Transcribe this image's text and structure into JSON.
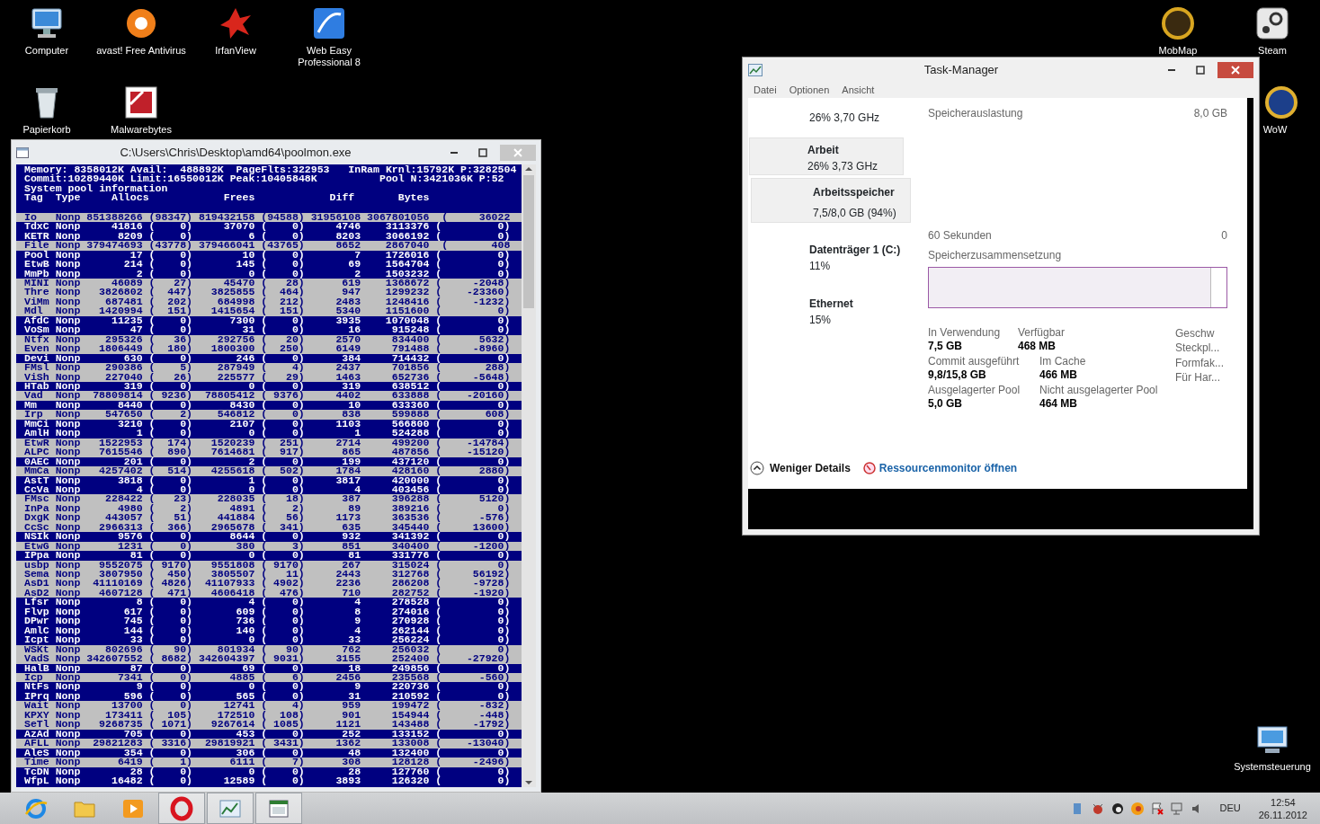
{
  "desktop_icons": [
    {
      "kind": "computer",
      "label": "Computer"
    },
    {
      "kind": "antivirus",
      "label": "avast! Free Antivirus"
    },
    {
      "kind": "image-viewer",
      "label": "IrfanView"
    },
    {
      "kind": "web-editor",
      "label": "Web Easy Professional 8"
    },
    {
      "kind": "recycle-bin",
      "label": "Papierkorb"
    },
    {
      "kind": "malware-scanner",
      "label": "Malwarebytes"
    },
    {
      "kind": "map-tool",
      "label": "MobMap"
    },
    {
      "kind": "game-client",
      "label": "Steam"
    },
    {
      "kind": "game",
      "label": "WoW"
    },
    {
      "kind": "control-panel",
      "label": "Systemsteuerung"
    }
  ],
  "console_window": {
    "title": "C:\\Users\\Chris\\Desktop\\amd64\\poolmon.exe",
    "header_lines": [
      "Memory: 8358012K Avail:  488892K  PageFlts:322953   InRam Krnl:15792K P:3282504",
      "Commit:10289440K Limit:16550012K Peak:10405848K          Pool N:3421036K P:52",
      "System pool information",
      "Tag  Type     Allocs            Frees            Diff       Bytes"
    ],
    "rows": [
      {
        "tag": "Io",
        "type": "Nonp",
        "allocs": "851388266",
        "allocs_change": "(98347)",
        "frees": "819432158",
        "frees_change": "(94588)",
        "diff": "31956108",
        "bytes": "3067801056",
        "bytes_change": "(     36022",
        "changed": true
      },
      {
        "tag": "TdxC",
        "type": "Nonp",
        "allocs": "41816",
        "allocs_change": "(    0)",
        "frees": "37070",
        "frees_change": "(    0)",
        "diff": "4746",
        "bytes": "3113376",
        "bytes_change": "(         0)",
        "changed": false
      },
      {
        "tag": "KETR",
        "type": "Nonp",
        "allocs": "8209",
        "allocs_change": "(    0)",
        "frees": "6",
        "frees_change": "(    0)",
        "diff": "8203",
        "bytes": "3066192",
        "bytes_change": "(         0)",
        "changed": false
      },
      {
        "tag": "File",
        "type": "Nonp",
        "allocs": "379474693",
        "allocs_change": "(43778)",
        "frees": "379466041",
        "frees_change": "(43765)",
        "diff": "8652",
        "bytes": "2867040",
        "bytes_change": "(       408",
        "changed": true
      },
      {
        "tag": "Pool",
        "type": "Nonp",
        "allocs": "17",
        "allocs_change": "(    0)",
        "frees": "10",
        "frees_change": "(    0)",
        "diff": "7",
        "bytes": "1726016",
        "bytes_change": "(         0)",
        "changed": false
      },
      {
        "tag": "EtwB",
        "type": "Nonp",
        "allocs": "214",
        "allocs_change": "(    0)",
        "frees": "145",
        "frees_change": "(    0)",
        "diff": "69",
        "bytes": "1564704",
        "bytes_change": "(         0)",
        "changed": false
      },
      {
        "tag": "MmPb",
        "type": "Nonp",
        "allocs": "2",
        "allocs_change": "(    0)",
        "frees": "0",
        "frees_change": "(    0)",
        "diff": "2",
        "bytes": "1503232",
        "bytes_change": "(         0)",
        "changed": false
      },
      {
        "tag": "MINI",
        "type": "Nonp",
        "allocs": "46089",
        "allocs_change": "(   27)",
        "frees": "45470",
        "frees_change": "(   28)",
        "diff": "619",
        "bytes": "1368672",
        "bytes_change": "(     -2048)",
        "changed": true
      },
      {
        "tag": "Thre",
        "type": "Nonp",
        "allocs": "3826802",
        "allocs_change": "(  447)",
        "frees": "3825855",
        "frees_change": "(  464)",
        "diff": "947",
        "bytes": "1299232",
        "bytes_change": "(    -23360)",
        "changed": true
      },
      {
        "tag": "ViMm",
        "type": "Nonp",
        "allocs": "687481",
        "allocs_change": "(  202)",
        "frees": "684998",
        "frees_change": "(  212)",
        "diff": "2483",
        "bytes": "1248416",
        "bytes_change": "(     -1232)",
        "changed": true
      },
      {
        "tag": "Mdl",
        "type": "Nonp",
        "allocs": "1420994",
        "allocs_change": "(  151)",
        "frees": "1415654",
        "frees_change": "(  151)",
        "diff": "5340",
        "bytes": "1151600",
        "bytes_change": "(         0)",
        "changed": true
      },
      {
        "tag": "AfdC",
        "type": "Nonp",
        "allocs": "11235",
        "allocs_change": "(    0)",
        "frees": "7300",
        "frees_change": "(    0)",
        "diff": "3935",
        "bytes": "1070048",
        "bytes_change": "(         0)",
        "changed": false
      },
      {
        "tag": "VoSm",
        "type": "Nonp",
        "allocs": "47",
        "allocs_change": "(    0)",
        "frees": "31",
        "frees_change": "(    0)",
        "diff": "16",
        "bytes": "915248",
        "bytes_change": "(         0)",
        "changed": false
      },
      {
        "tag": "Ntfx",
        "type": "Nonp",
        "allocs": "295326",
        "allocs_change": "(   36)",
        "frees": "292756",
        "frees_change": "(   20)",
        "diff": "2570",
        "bytes": "834400",
        "bytes_change": "(      5632)",
        "changed": true
      },
      {
        "tag": "Even",
        "type": "Nonp",
        "allocs": "1806449",
        "allocs_change": "(  180)",
        "frees": "1800300",
        "frees_change": "(  250)",
        "diff": "6149",
        "bytes": "791488",
        "bytes_change": "(     -8960)",
        "changed": true
      },
      {
        "tag": "Devi",
        "type": "Nonp",
        "allocs": "630",
        "allocs_change": "(    0)",
        "frees": "246",
        "frees_change": "(    0)",
        "diff": "384",
        "bytes": "714432",
        "bytes_change": "(         0)",
        "changed": false
      },
      {
        "tag": "FMsl",
        "type": "Nonp",
        "allocs": "290386",
        "allocs_change": "(    5)",
        "frees": "287949",
        "frees_change": "(    4)",
        "diff": "2437",
        "bytes": "701856",
        "bytes_change": "(       288)",
        "changed": true
      },
      {
        "tag": "ViSh",
        "type": "Nonp",
        "allocs": "227040",
        "allocs_change": "(   26)",
        "frees": "225577",
        "frees_change": "(   29)",
        "diff": "1463",
        "bytes": "652736",
        "bytes_change": "(     -5648)",
        "changed": true
      },
      {
        "tag": "HTab",
        "type": "Nonp",
        "allocs": "319",
        "allocs_change": "(    0)",
        "frees": "0",
        "frees_change": "(    0)",
        "diff": "319",
        "bytes": "638512",
        "bytes_change": "(         0)",
        "changed": false
      },
      {
        "tag": "Vad",
        "type": "Nonp",
        "allocs": "78809814",
        "allocs_change": "( 9236)",
        "frees": "78805412",
        "frees_change": "( 9376)",
        "diff": "4402",
        "bytes": "633888",
        "bytes_change": "(    -20160)",
        "changed": true
      },
      {
        "tag": "Mm",
        "type": "Nonp",
        "allocs": "8440",
        "allocs_change": "(    0)",
        "frees": "8430",
        "frees_change": "(    0)",
        "diff": "10",
        "bytes": "633360",
        "bytes_change": "(         0)",
        "changed": false
      },
      {
        "tag": "Irp",
        "type": "Nonp",
        "allocs": "547650",
        "allocs_change": "(    2)",
        "frees": "546812",
        "frees_change": "(    0)",
        "diff": "838",
        "bytes": "599888",
        "bytes_change": "(       608)",
        "changed": true
      },
      {
        "tag": "MmCi",
        "type": "Nonp",
        "allocs": "3210",
        "allocs_change": "(    0)",
        "frees": "2107",
        "frees_change": "(    0)",
        "diff": "1103",
        "bytes": "566800",
        "bytes_change": "(         0)",
        "changed": false
      },
      {
        "tag": "AmlH",
        "type": "Nonp",
        "allocs": "1",
        "allocs_change": "(    0)",
        "frees": "0",
        "frees_change": "(    0)",
        "diff": "1",
        "bytes": "524288",
        "bytes_change": "(         0)",
        "changed": false
      },
      {
        "tag": "EtwR",
        "type": "Nonp",
        "allocs": "1522953",
        "allocs_change": "(  174)",
        "frees": "1520239",
        "frees_change": "(  251)",
        "diff": "2714",
        "bytes": "499200",
        "bytes_change": "(    -14784)",
        "changed": true
      },
      {
        "tag": "ALPC",
        "type": "Nonp",
        "allocs": "7615546",
        "allocs_change": "(  890)",
        "frees": "7614681",
        "frees_change": "(  917)",
        "diff": "865",
        "bytes": "487856",
        "bytes_change": "(    -15120)",
        "changed": true
      },
      {
        "tag": "0AEC",
        "type": "Nonp",
        "allocs": "201",
        "allocs_change": "(    0)",
        "frees": "2",
        "frees_change": "(    0)",
        "diff": "199",
        "bytes": "437120",
        "bytes_change": "(         0)",
        "changed": false
      },
      {
        "tag": "MmCa",
        "type": "Nonp",
        "allocs": "4257402",
        "allocs_change": "(  514)",
        "frees": "4255618",
        "frees_change": "(  502)",
        "diff": "1784",
        "bytes": "428160",
        "bytes_change": "(      2880)",
        "changed": true
      },
      {
        "tag": "AstT",
        "type": "Nonp",
        "allocs": "3818",
        "allocs_change": "(    0)",
        "frees": "1",
        "frees_change": "(    0)",
        "diff": "3817",
        "bytes": "420000",
        "bytes_change": "(         0)",
        "changed": false
      },
      {
        "tag": "CcVa",
        "type": "Nonp",
        "allocs": "4",
        "allocs_change": "(    0)",
        "frees": "0",
        "frees_change": "(    0)",
        "diff": "4",
        "bytes": "403456",
        "bytes_change": "(         0)",
        "changed": false
      },
      {
        "tag": "FMsc",
        "type": "Nonp",
        "allocs": "228422",
        "allocs_change": "(   23)",
        "frees": "228035",
        "frees_change": "(   18)",
        "diff": "387",
        "bytes": "396288",
        "bytes_change": "(      5120)",
        "changed": true
      },
      {
        "tag": "InPa",
        "type": "Nonp",
        "allocs": "4980",
        "allocs_change": "(    2)",
        "frees": "4891",
        "frees_change": "(    2)",
        "diff": "89",
        "bytes": "389216",
        "bytes_change": "(         0)",
        "changed": true
      },
      {
        "tag": "DxgK",
        "type": "Nonp",
        "allocs": "443057",
        "allocs_change": "(   51)",
        "frees": "441884",
        "frees_change": "(   56)",
        "diff": "1173",
        "bytes": "363536",
        "bytes_change": "(      -576)",
        "changed": true
      },
      {
        "tag": "CcSc",
        "type": "Nonp",
        "allocs": "2966313",
        "allocs_change": "(  366)",
        "frees": "2965678",
        "frees_change": "(  341)",
        "diff": "635",
        "bytes": "345440",
        "bytes_change": "(     13600)",
        "changed": true
      },
      {
        "tag": "NSIk",
        "type": "Nonp",
        "allocs": "9576",
        "allocs_change": "(    0)",
        "frees": "8644",
        "frees_change": "(    0)",
        "diff": "932",
        "bytes": "341392",
        "bytes_change": "(         0)",
        "changed": false
      },
      {
        "tag": "EtwG",
        "type": "Nonp",
        "allocs": "1231",
        "allocs_change": "(    0)",
        "frees": "380",
        "frees_change": "(    3)",
        "diff": "851",
        "bytes": "340400",
        "bytes_change": "(     -1200)",
        "changed": true
      },
      {
        "tag": "IPpa",
        "type": "Nonp",
        "allocs": "81",
        "allocs_change": "(    0)",
        "frees": "0",
        "frees_change": "(    0)",
        "diff": "81",
        "bytes": "331776",
        "bytes_change": "(         0)",
        "changed": false
      },
      {
        "tag": "usbp",
        "type": "Nonp",
        "allocs": "9552075",
        "allocs_change": "( 9170)",
        "frees": "9551808",
        "frees_change": "( 9170)",
        "diff": "267",
        "bytes": "315024",
        "bytes_change": "(         0)",
        "changed": true
      },
      {
        "tag": "Sema",
        "type": "Nonp",
        "allocs": "3807950",
        "allocs_change": "(  450)",
        "frees": "3805507",
        "frees_change": "(   11)",
        "diff": "2443",
        "bytes": "312768",
        "bytes_change": "(     56192)",
        "changed": true
      },
      {
        "tag": "AsD1",
        "type": "Nonp",
        "allocs": "41110169",
        "allocs_change": "( 4826)",
        "frees": "41107933",
        "frees_change": "( 4902)",
        "diff": "2236",
        "bytes": "286208",
        "bytes_change": "(     -9728)",
        "changed": true
      },
      {
        "tag": "AsD2",
        "type": "Nonp",
        "allocs": "4607128",
        "allocs_change": "(  471)",
        "frees": "4606418",
        "frees_change": "(  476)",
        "diff": "710",
        "bytes": "282752",
        "bytes_change": "(     -1920)",
        "changed": true
      },
      {
        "tag": "Lfsr",
        "type": "Nonp",
        "allocs": "8",
        "allocs_change": "(    0)",
        "frees": "4",
        "frees_change": "(    0)",
        "diff": "4",
        "bytes": "278528",
        "bytes_change": "(         0)",
        "changed": false
      },
      {
        "tag": "Flvp",
        "type": "Nonp",
        "allocs": "617",
        "allocs_change": "(    0)",
        "frees": "609",
        "frees_change": "(    0)",
        "diff": "8",
        "bytes": "274016",
        "bytes_change": "(         0)",
        "changed": false
      },
      {
        "tag": "DPwr",
        "type": "Nonp",
        "allocs": "745",
        "allocs_change": "(    0)",
        "frees": "736",
        "frees_change": "(    0)",
        "diff": "9",
        "bytes": "270928",
        "bytes_change": "(         0)",
        "changed": false
      },
      {
        "tag": "AmlC",
        "type": "Nonp",
        "allocs": "144",
        "allocs_change": "(    0)",
        "frees": "140",
        "frees_change": "(    0)",
        "diff": "4",
        "bytes": "262144",
        "bytes_change": "(         0)",
        "changed": false
      },
      {
        "tag": "Icpt",
        "type": "Nonp",
        "allocs": "33",
        "allocs_change": "(    0)",
        "frees": "0",
        "frees_change": "(    0)",
        "diff": "33",
        "bytes": "256224",
        "bytes_change": "(         0)",
        "changed": false
      },
      {
        "tag": "WSKt",
        "type": "Nonp",
        "allocs": "802696",
        "allocs_change": "(   90)",
        "frees": "801934",
        "frees_change": "(   90)",
        "diff": "762",
        "bytes": "256032",
        "bytes_change": "(         0)",
        "changed": true
      },
      {
        "tag": "VadS",
        "type": "Nonp",
        "allocs": "342607552",
        "allocs_change": "( 8682)",
        "frees": "342604397",
        "frees_change": "( 9031)",
        "diff": "3155",
        "bytes": "252400",
        "bytes_change": "(    -27920)",
        "changed": true
      },
      {
        "tag": "HalB",
        "type": "Nonp",
        "allocs": "87",
        "allocs_change": "(    0)",
        "frees": "69",
        "frees_change": "(    0)",
        "diff": "18",
        "bytes": "249856",
        "bytes_change": "(         0)",
        "changed": false
      },
      {
        "tag": "Icp",
        "type": "Nonp",
        "allocs": "7341",
        "allocs_change": "(    0)",
        "frees": "4885",
        "frees_change": "(    6)",
        "diff": "2456",
        "bytes": "235568",
        "bytes_change": "(      -560)",
        "changed": true
      },
      {
        "tag": "NtFs",
        "type": "Nonp",
        "allocs": "9",
        "allocs_change": "(    0)",
        "frees": "0",
        "frees_change": "(    0)",
        "diff": "9",
        "bytes": "220736",
        "bytes_change": "(         0)",
        "changed": false
      },
      {
        "tag": "IPrq",
        "type": "Nonp",
        "allocs": "596",
        "allocs_change": "(    0)",
        "frees": "565",
        "frees_change": "(    0)",
        "diff": "31",
        "bytes": "210592",
        "bytes_change": "(         0)",
        "changed": false
      },
      {
        "tag": "Wait",
        "type": "Nonp",
        "allocs": "13700",
        "allocs_change": "(    0)",
        "frees": "12741",
        "frees_change": "(    4)",
        "diff": "959",
        "bytes": "199472",
        "bytes_change": "(      -832)",
        "changed": true
      },
      {
        "tag": "KPXY",
        "type": "Nonp",
        "allocs": "173411",
        "allocs_change": "(  105)",
        "frees": "172510",
        "frees_change": "(  108)",
        "diff": "901",
        "bytes": "154944",
        "bytes_change": "(      -448)",
        "changed": true
      },
      {
        "tag": "SeTl",
        "type": "Nonp",
        "allocs": "9268735",
        "allocs_change": "( 1071)",
        "frees": "9267614",
        "frees_change": "( 1085)",
        "diff": "1121",
        "bytes": "143488",
        "bytes_change": "(     -1792)",
        "changed": true
      },
      {
        "tag": "AzAd",
        "type": "Nonp",
        "allocs": "705",
        "allocs_change": "(    0)",
        "frees": "453",
        "frees_change": "(    0)",
        "diff": "252",
        "bytes": "133152",
        "bytes_change": "(         0)",
        "changed": false
      },
      {
        "tag": "AFLL",
        "type": "Nonp",
        "allocs": "29821283",
        "allocs_change": "( 3316)",
        "frees": "29819921",
        "frees_change": "( 3431)",
        "diff": "1362",
        "bytes": "133008",
        "bytes_change": "(    -13040)",
        "changed": true
      },
      {
        "tag": "AleS",
        "type": "Nonp",
        "allocs": "354",
        "allocs_change": "(    0)",
        "frees": "306",
        "frees_change": "(    0)",
        "diff": "48",
        "bytes": "132400",
        "bytes_change": "(         0)",
        "changed": false
      },
      {
        "tag": "Time",
        "type": "Nonp",
        "allocs": "6419",
        "allocs_change": "(    1)",
        "frees": "6111",
        "frees_change": "(    7)",
        "diff": "308",
        "bytes": "128128",
        "bytes_change": "(     -2496)",
        "changed": true
      },
      {
        "tag": "TcDN",
        "type": "Nonp",
        "allocs": "28",
        "allocs_change": "(    0)",
        "frees": "0",
        "frees_change": "(    0)",
        "diff": "28",
        "bytes": "127760",
        "bytes_change": "(         0)",
        "changed": false
      },
      {
        "tag": "WfpL",
        "type": "Nonp",
        "allocs": "16482",
        "allocs_change": "(    0)",
        "frees": "12589",
        "frees_change": "(    0)",
        "diff": "3893",
        "bytes": "126320",
        "bytes_change": "(         0)",
        "changed": false
      }
    ]
  },
  "task_manager": {
    "title": "Task-Manager",
    "menu": [
      "Datei",
      "Optionen",
      "Ansicht"
    ],
    "sidebar": [
      {
        "value": "26% 3,70 GHz",
        "selected": false
      },
      {
        "title": "Arbeit",
        "value": "26% 3,73 GHz",
        "selected": true
      },
      {
        "title": "Arbeitsspeicher",
        "value": "7,5/8,0 GB (94%)",
        "selected": true
      },
      {
        "title": "Datenträger 1 (C:)",
        "value": "11%",
        "selected": false
      },
      {
        "title": "Ethernet",
        "value": "15%",
        "selected": false
      }
    ],
    "usage_label": "Speicherauslastung",
    "usage_total": "8,0 GB",
    "graph_span": "60 Sekunden",
    "graph_min": "0",
    "composition_label": "Speicherzusammensetzung",
    "composition": {
      "level": 0.95
    },
    "stat_rows": [
      [
        {
          "label": "In Verwendung",
          "value": "7,5 GB"
        },
        {
          "label": "Verfügbar",
          "value": "468 MB"
        }
      ],
      [
        {
          "label": "Commit ausgeführt",
          "value": "9,8/15,8 GB"
        },
        {
          "label": "Im Cache",
          "value": "466 MB"
        }
      ],
      [
        {
          "label": "Ausgelagerter Pool",
          "value": "5,0 GB"
        },
        {
          "label": "Nicht ausgelagerter Pool",
          "value": "464 MB"
        }
      ]
    ],
    "detail_labels": [
      "Geschw",
      "Steckpl...",
      "Formfak...",
      "Für Har..."
    ],
    "fewer_details": "Weniger Details",
    "resource_monitor_link": "Ressourcenmonitor öffnen"
  },
  "taskbar": {
    "apps": [
      {
        "kind": "browser",
        "running": false
      },
      {
        "kind": "file-manager",
        "running": false
      },
      {
        "kind": "media-player",
        "running": false
      },
      {
        "kind": "opera",
        "running": true
      },
      {
        "kind": "task-manager",
        "running": true
      },
      {
        "kind": "console",
        "running": true
      }
    ],
    "language": "DEU",
    "time": "12:54",
    "date": "26.11.2012"
  }
}
